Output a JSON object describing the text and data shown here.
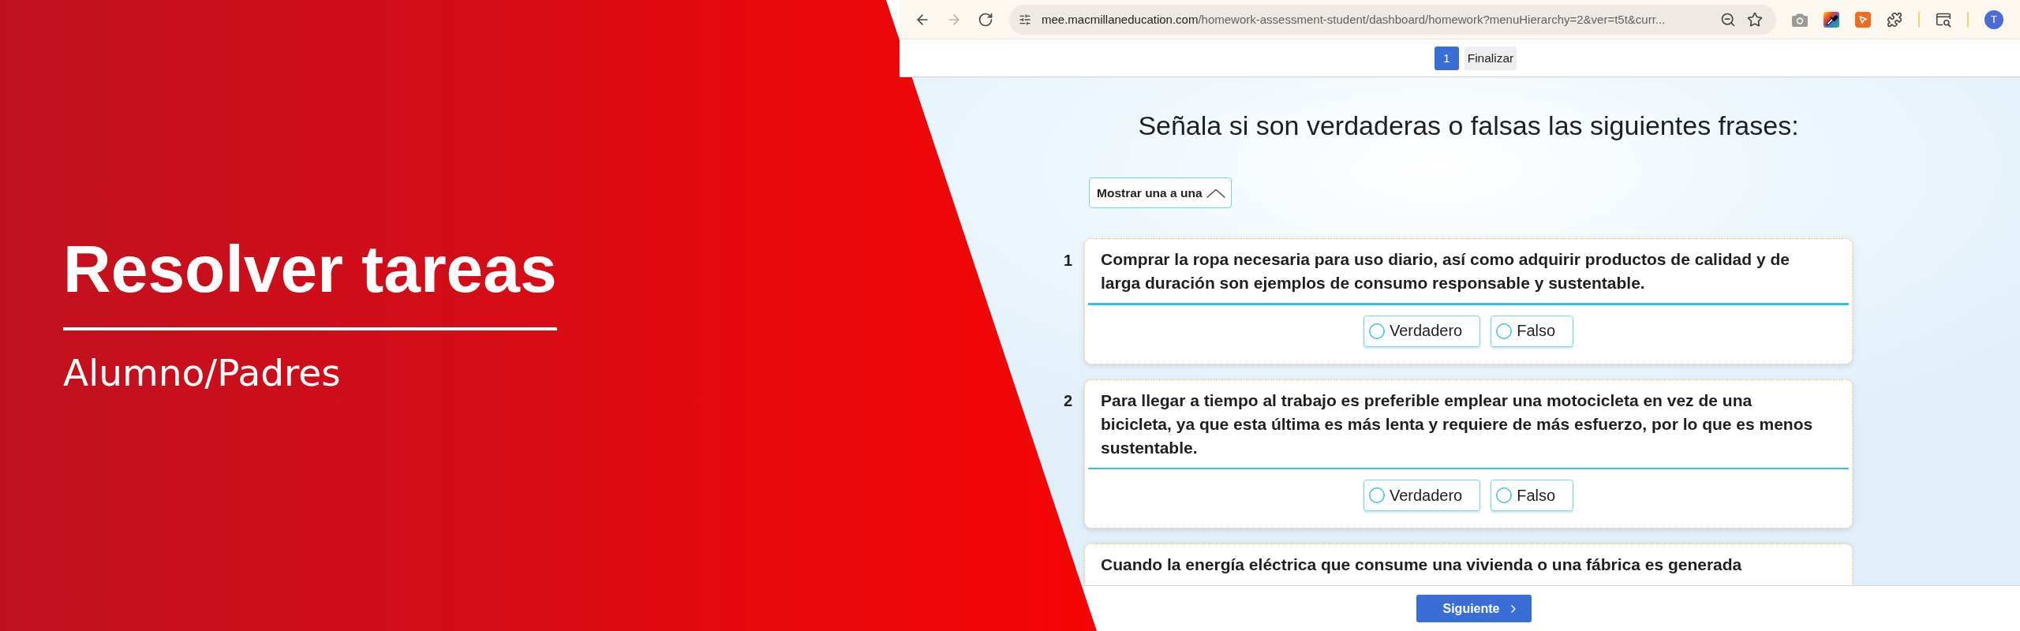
{
  "banner": {
    "title": "Resolver tareas",
    "subtitle": "Alumno/Padres"
  },
  "browser": {
    "nav_buttons": [
      {
        "kind": "back",
        "disabled": false
      },
      {
        "kind": "forward",
        "disabled": true
      },
      {
        "kind": "reload",
        "disabled": false
      }
    ],
    "url": {
      "host": "mee.macmillaneducation.com",
      "path": "/homework-assessment-student/dashboard/homework?menuHierarchy=2&ver=t5t&curr..."
    },
    "profile_initial": "T"
  },
  "page_nav": [
    {
      "label": "1",
      "selected": true
    },
    {
      "label": "Finalizar",
      "selected": false
    }
  ],
  "instruction": "Señala si son verdaderas o falsas las siguientes frases:",
  "display_toggle": {
    "label": "Mostrar una a una"
  },
  "questions": [
    {
      "number": "1",
      "text": "Comprar la ropa necesaria para uso diario, así como adquirir productos de calidad y de larga duración son ejemplos de consumo responsable y sustentable.",
      "options": [
        {
          "label": "Verdadero",
          "selected": false
        },
        {
          "label": "Falso",
          "selected": false
        }
      ]
    },
    {
      "number": "2",
      "text": "Para llegar a tiempo al trabajo es preferible emplear una motocicleta en vez de una bicicleta, ya que esta última es más lenta y requiere de más esfuerzo, por lo que es menos sustentable.",
      "options": [
        {
          "label": "Verdadero",
          "selected": false
        },
        {
          "label": "Falso",
          "selected": false
        }
      ]
    },
    {
      "text": "Cuando la energía eléctrica que consume una vivienda o una fábrica es generada"
    }
  ],
  "footer": {
    "next_button": "Siguiente"
  }
}
